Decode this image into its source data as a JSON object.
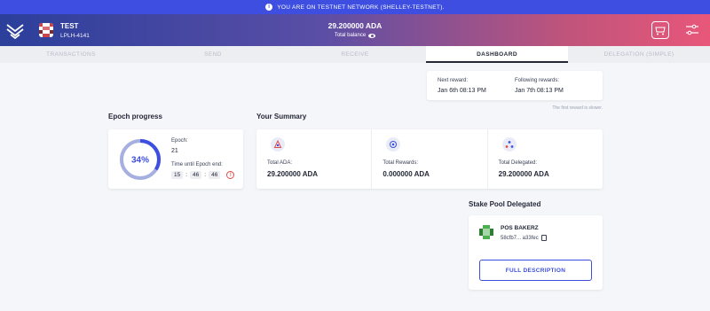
{
  "banner": {
    "text": "YOU ARE ON TESTNET NETWORK (SHELLEY-TESTNET).",
    "icon": "info-icon"
  },
  "header": {
    "wallet_name": "TEST",
    "wallet_plate": "LPLH-4141",
    "balance": "29.200000 ADA",
    "balance_label": "Total balance",
    "gradient_colors": [
      "#2b3f9b",
      "#e8577a"
    ]
  },
  "tabs": [
    {
      "label": "TRANSACTIONS"
    },
    {
      "label": "SEND"
    },
    {
      "label": "RECEIVE"
    },
    {
      "label": "DASHBOARD"
    },
    {
      "label": "DELEGATION (SIMPLE)"
    }
  ],
  "rewards": {
    "next_label": "Next reward:",
    "next_value": "Jan 6th 08:13 PM",
    "following_label": "Following rewards:",
    "following_value": "Jan 7th 08:13 PM",
    "note": "The first reward is slower."
  },
  "epoch": {
    "title": "Epoch progress",
    "percent_text": "34%",
    "progress": 0.34,
    "epoch_label": "Epoch:",
    "epoch_value": "21",
    "time_label": "Time until Epoch end:",
    "hours": "15",
    "minutes": "46",
    "seconds": "46",
    "separator": ":",
    "warn_symbol": "!"
  },
  "summary": {
    "title": "Your Summary",
    "items": [
      {
        "label": "Total ADA:",
        "value": "29.200000 ADA",
        "icon": "ada-icon"
      },
      {
        "label": "Total Rewards:",
        "value": "0.000000 ADA",
        "icon": "rewards-icon"
      },
      {
        "label": "Total Delegated:",
        "value": "29.200000 ADA",
        "icon": "delegated-icon"
      }
    ]
  },
  "stake_pool": {
    "title": "Stake Pool Delegated",
    "name": "POS BAKERZ",
    "id": "58cfb7... a33fec",
    "button_label": "FULL DESCRIPTION"
  },
  "colors": {
    "accent": "#3d4ee0",
    "ring_track": "#a5b0e0",
    "ring_fill": "#3d4ee0",
    "warning": "#e04a4a"
  }
}
